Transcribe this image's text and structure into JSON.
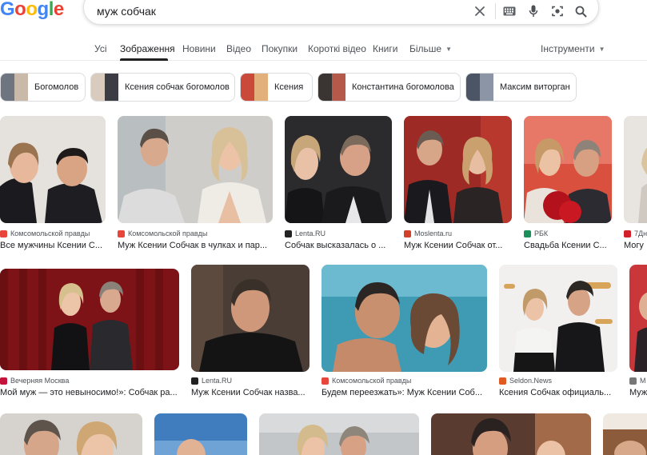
{
  "logo": {
    "letters": [
      "G",
      "o",
      "o",
      "g",
      "l",
      "e"
    ],
    "colors": [
      "#4285f4",
      "#ea4335",
      "#fbbc05",
      "#4285f4",
      "#34a853",
      "#ea4335"
    ]
  },
  "search": {
    "value": "муж собчак"
  },
  "tabs": [
    {
      "label": "Усі"
    },
    {
      "label": "Зображення",
      "active": true
    },
    {
      "label": "Новини"
    },
    {
      "label": "Відео"
    },
    {
      "label": "Покупки"
    },
    {
      "label": "Короткі відео"
    },
    {
      "label": "Книги"
    },
    {
      "label": "Більше"
    },
    {
      "label": "Інструменти"
    }
  ],
  "chips": [
    {
      "label": "Богомолов"
    },
    {
      "label": "Ксения собчак богомолов"
    },
    {
      "label": "Ксения"
    },
    {
      "label": "Константина богомолова"
    },
    {
      "label": "Максим виторган"
    }
  ],
  "row1": [
    {
      "source": "Комсомольской правды",
      "title": "Все мужчины Ксении С...",
      "fav": "#e8453c"
    },
    {
      "source": "Комсомольской правды",
      "title": "Муж Ксении Собчак в чулках и пар...",
      "fav": "#e8453c"
    },
    {
      "source": "Lenta.RU",
      "title": "Собчак высказалась о ...",
      "fav": "#222222"
    },
    {
      "source": "Moslenta.ru",
      "title": "Муж Ксении Собчак от...",
      "fav": "#d23f2a"
    },
    {
      "source": "РБК",
      "title": "Свадьба Ксении С...",
      "fav": "#1a8f5a"
    },
    {
      "source": "7Дн",
      "title": "Могу",
      "fav": "#d21f2a"
    }
  ],
  "row2": [
    {
      "source": "Вечерняя Москва",
      "title": "Мой муж — это невыносимо!»: Собчак ра...",
      "fav": "#c5143b"
    },
    {
      "source": "Lenta.RU",
      "title": "Муж Ксении Собчак назва...",
      "fav": "#222222"
    },
    {
      "source": "Комсомольской правды",
      "title": "Будем переезжать»: Муж Ксении Соб...",
      "fav": "#e8453c"
    },
    {
      "source": "Seldon.News",
      "title": "Ксения Собчак официаль...",
      "fav": "#e05a22"
    },
    {
      "source": "М",
      "title": "Муж",
      "fav": "#777777"
    }
  ],
  "icons": [
    "close-icon",
    "keyboard-icon",
    "mic-icon",
    "camera-icon",
    "search-icon"
  ]
}
